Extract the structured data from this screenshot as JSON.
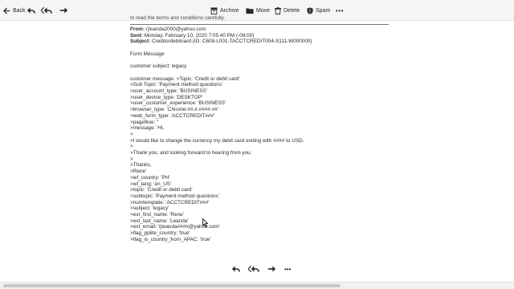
{
  "toolbar": {
    "back_label": "Back",
    "archive_label": "Archive",
    "move_label": "Move",
    "delete_label": "Delete",
    "spam_label": "Spam",
    "more_label": "•••"
  },
  "message": {
    "cut_text": "to read the terms and conditions carefully.",
    "from_label": "From:",
    "from_value": "rjleanda2000@yahoo.com",
    "sent_label": "Sent:",
    "sent_value": "Monday, February 10, 2020 7:05:40 PM (-08:00)",
    "subject_label": "Subject:",
    "subject_value": "Creditordebitcard (ID: C608-L001-TACCTCREDIT004-S111-W000000)",
    "lines": [
      "Form Message",
      "",
      "customer subject: legacy",
      "",
      "customer message: >Topic: 'Credit or debit card'",
      ">Sub Topic: 'Payment method questions'",
      ">user_account_type: 'BUSINESS'",
      ">user_device_type: 'DESKTOP'",
      ">user_customer_experience: 'BUSINESS'",
      ">browser_type: 'Chrome:##.#.####.##'",
      ">web_form_type: 'ACCTCREDIT###'",
      ">pageflow: ''",
      ">message: 'Hi,",
      ">",
      ">I would like to change the currency my debit card ending with #### to USD.",
      ">",
      ">Thank you; and looking forward to hearing from you.",
      ">",
      ">Thanks,",
      ">Rene'",
      ">wf_country: 'PH'",
      ">wf_lang: 'en_US'",
      ">topic: 'Credit or debit card'",
      ">subtopic: 'Payment method questions'",
      ">numtemplate: 'ACCTCREDIT###'",
      ">subject: 'legacy'",
      ">ext_first_name: 'Rene'",
      ">ext_last_name: 'Leanda'",
      ">ext_email: 'rjleanda####@yahoo.com'",
      ">flag_pplite_country: 'true'",
      ">flag_is_country_from_APAC: 'true'"
    ]
  },
  "colors": {
    "toolbar_bg": "#f4f5f7",
    "icon": "#26282a",
    "text": "#2b2b2b"
  }
}
